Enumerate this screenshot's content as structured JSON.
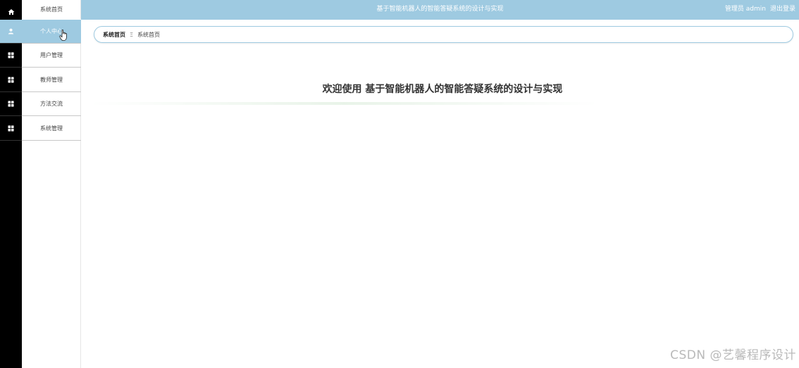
{
  "header": {
    "title": "基于智能机器人的智能答疑系统的设计与实现",
    "user_label": "管理员 admin",
    "logout_label": "退出登录"
  },
  "sidebar": {
    "items": [
      {
        "label": "系统首页",
        "icon": "home-icon"
      },
      {
        "label": "个人中心",
        "icon": "user-icon",
        "active": true
      },
      {
        "label": "用户管理",
        "icon": "grid-icon"
      },
      {
        "label": "教师管理",
        "icon": "grid-icon"
      },
      {
        "label": "方法交流",
        "icon": "grid-icon"
      },
      {
        "label": "系统管理",
        "icon": "grid-icon"
      }
    ]
  },
  "breadcrumb": {
    "root": "系统首页",
    "separator": "Ξ",
    "current": "系统首页"
  },
  "main": {
    "welcome": "欢迎使用 基于智能机器人的智能答疑系统的设计与实现"
  },
  "watermark": "CSDN @艺馨程序设计",
  "colors": {
    "accent": "#9ecae1",
    "rail": "#000000",
    "text": "#333333"
  }
}
